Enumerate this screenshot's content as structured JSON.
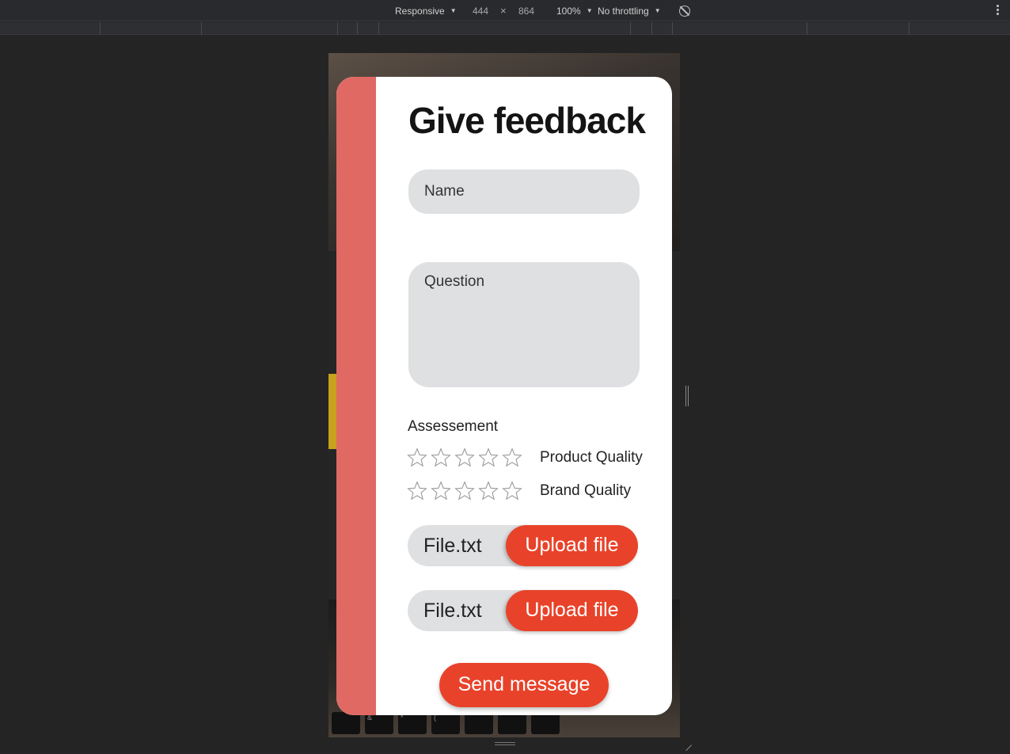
{
  "devtools": {
    "device": "Responsive",
    "width": "444",
    "times": "×",
    "height": "864",
    "zoom": "100%",
    "throttling": "No throttling"
  },
  "background_keys": [
    "",
    "&",
    "*",
    "(",
    "",
    "",
    ""
  ],
  "form": {
    "title": "Give feedback",
    "name_placeholder": "Name",
    "question_placeholder": "Question",
    "assessment_label": "Assessement",
    "ratings": [
      {
        "label": "Product Quality",
        "stars": 0,
        "max": 5
      },
      {
        "label": "Brand Quality",
        "stars": 0,
        "max": 5
      }
    ],
    "uploads": [
      {
        "file_name": "File.txt",
        "button_label": "Upload file"
      },
      {
        "file_name": "File.txt",
        "button_label": "Upload file"
      }
    ],
    "send_label": "Send message"
  },
  "colors": {
    "accent_bar": "#e06a63",
    "button": "#e8432a",
    "field_bg": "#dfe0e2"
  }
}
